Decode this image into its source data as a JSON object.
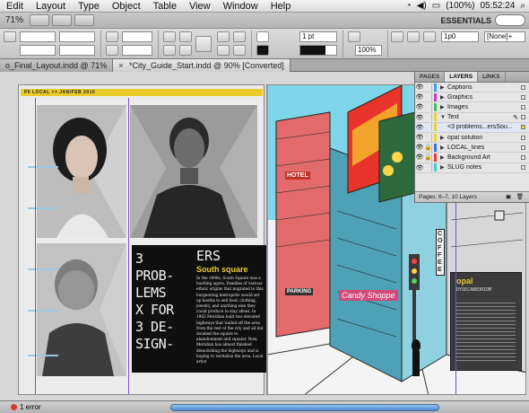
{
  "menu": {
    "items": [
      "Edit",
      "Layout",
      "Type",
      "Object",
      "Table",
      "View",
      "Window",
      "Help"
    ],
    "battery": "(100%)",
    "clock": "05:52:24"
  },
  "appbar": {
    "zoom": "71%",
    "workspace": "ESSENTIALS"
  },
  "controlbar": {
    "stroke_weight": "1 pt",
    "scale": "100%",
    "offset": "1p0",
    "style": "[None]+"
  },
  "tabs": [
    {
      "label": "o_Final_Layout.indd @ 71%"
    },
    {
      "label": "*City_Guide_Start.indd @ 90% [Converted]"
    }
  ],
  "left_page": {
    "folio": "P6  LOCAL >> JAN/FEB 2010",
    "big_left": "3\nPROB-\nLEMS\nX FOR\n3 DE-\nSIGN-",
    "big_right": "ERS",
    "subhead": "South square",
    "body": "In the 1890s, South Square was a bustling agora. Families of various ethnic origins that migrated to this burgeoning metropolis would set up booths to sell food, clothing, jewelry, and anything else they could produce to stay afloat. In 1963 Meridian built two elevated highways that walled off the area from the rest of the city and all but doomed the square to abandonment and squalor. Now, Meridian has almost finished demolishing the highways and is hoping to revitalize the area. Local artist"
  },
  "right_page": {
    "sign_hotel": "HOTEL",
    "sign_cafe": "Candy Shoppe",
    "sign_coffee": "COFFEE",
    "sign_parking": "PARKING",
    "card_title": "opal",
    "card_sub": "DYSECANEDRIOM"
  },
  "layers_panel": {
    "tabs": [
      "PAGES",
      "LAYERS",
      "LINKS"
    ],
    "layers": [
      {
        "name": "Captions",
        "color": "#3aa0e8"
      },
      {
        "name": "Graphics",
        "color": "#c83cc8"
      },
      {
        "name": "Images",
        "color": "#44c060"
      },
      {
        "name": "Text",
        "color": "#e8d43a"
      },
      {
        "name": "<3 problems...ersSou...",
        "color": "#e8d43a"
      },
      {
        "name": "opal solution",
        "color": "#e8d43a"
      },
      {
        "name": "LOCAL_lines",
        "color": "#3a6ee8"
      },
      {
        "name": "Background Art",
        "color": "#e83a3a"
      },
      {
        "name": "SLUG notes",
        "color": "#3ad0d0"
      }
    ],
    "footer": "Pages: 6–7, 10 Layers"
  },
  "status": {
    "errors": "1 error"
  },
  "colors": {
    "folio_yellow": "#e9cc2a",
    "frame_purple": "#7a4fd0",
    "error_red": "#d43a2a"
  }
}
